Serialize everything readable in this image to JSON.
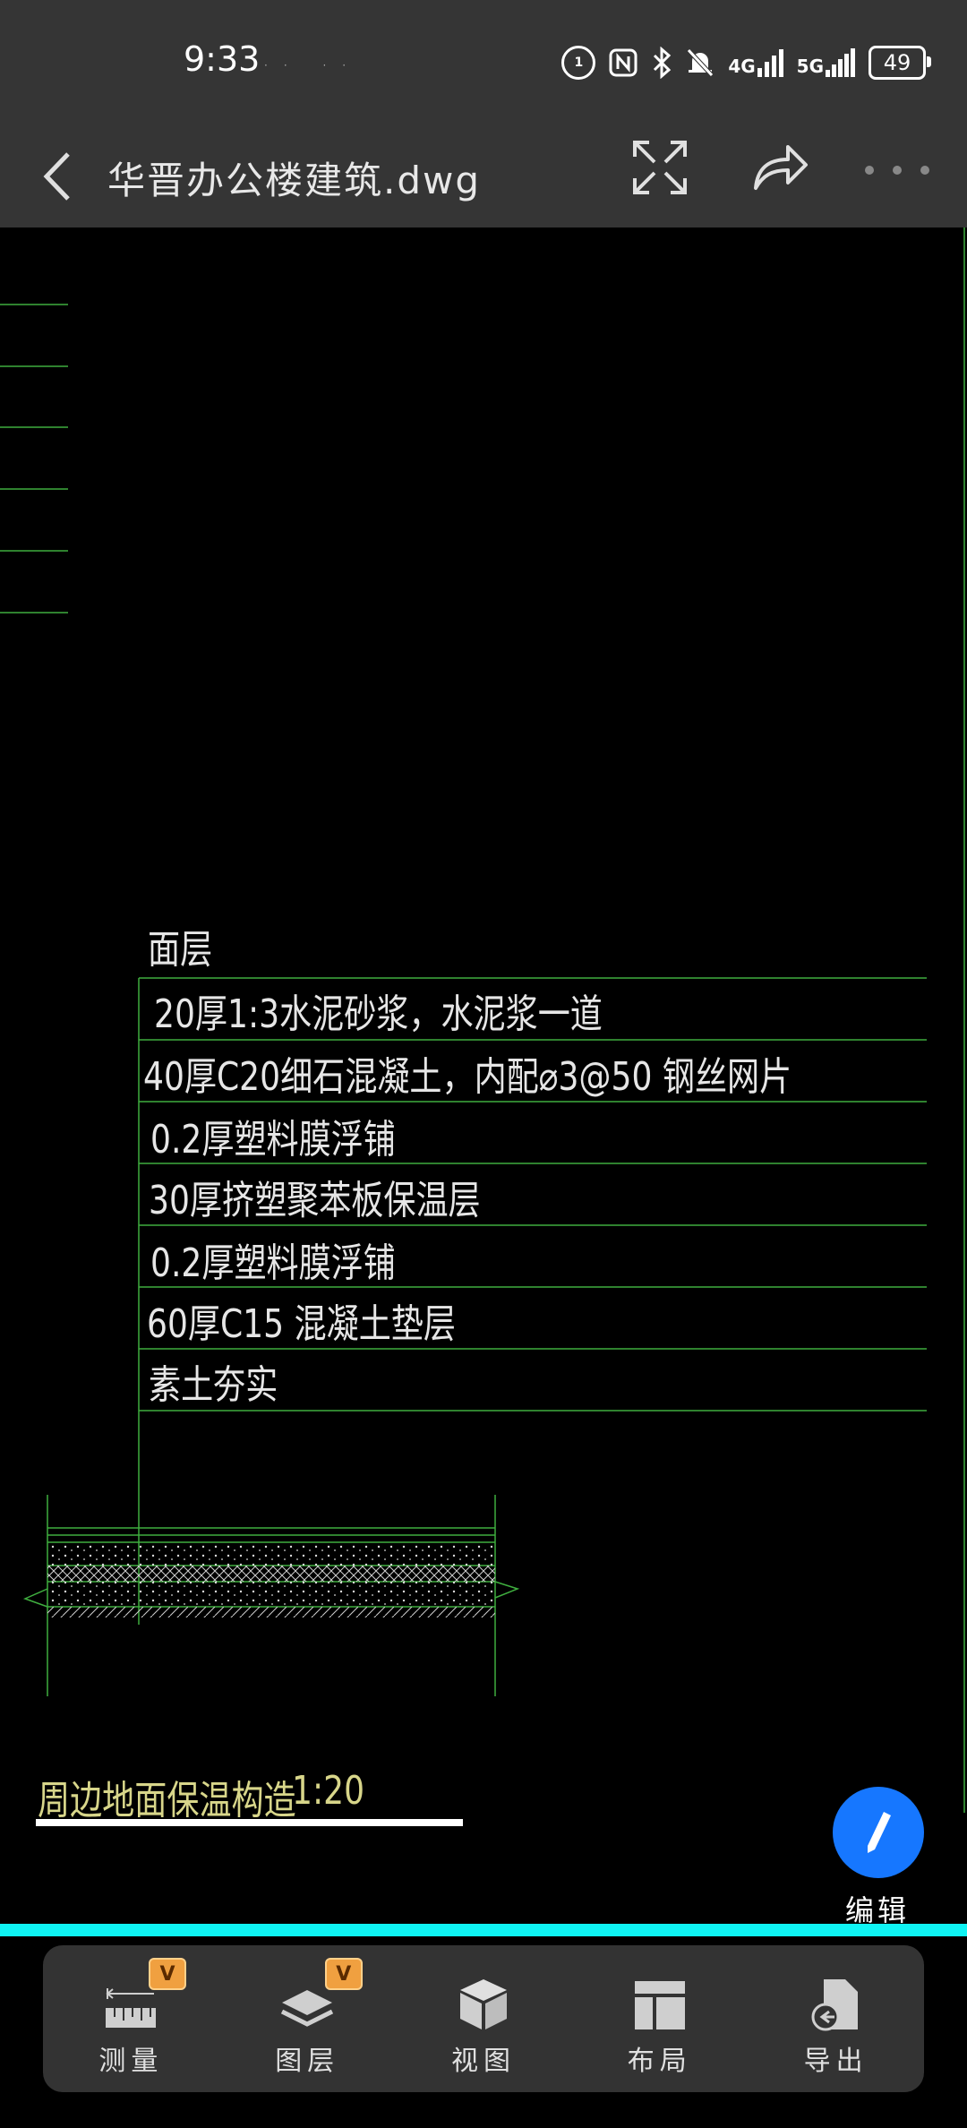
{
  "status": {
    "time": "9:33",
    "dots": "··  ··",
    "network_4g": "4G",
    "network_5g": "5G",
    "battery": "49"
  },
  "header": {
    "title": "华晋办公楼建筑.dwg"
  },
  "drawing": {
    "layer_header": "面层",
    "layers": [
      "20厚1:3水泥砂浆，水泥浆一道",
      "40厚C20细石混凝土，内配⌀3@50 钢丝网片",
      "0.2厚塑料膜浮铺",
      "30厚挤塑聚苯板保温层",
      "0.2厚塑料膜浮铺",
      "60厚C15 混凝土垫层",
      "素土夯实"
    ],
    "caption": "周边地面保温构造",
    "scale": "1:20",
    "colors": {
      "line": "#3fae3f",
      "text": "#e6e6e6",
      "caption": "#d8d68a"
    }
  },
  "edit": {
    "label": "编辑",
    "color": "#1677ff"
  },
  "toolbar": {
    "items": [
      {
        "label": "测量",
        "icon": "ruler-icon",
        "vip": "V"
      },
      {
        "label": "图层",
        "icon": "layers-icon",
        "vip": "V"
      },
      {
        "label": "视图",
        "icon": "cube-icon",
        "vip": ""
      },
      {
        "label": "布局",
        "icon": "layout-icon",
        "vip": ""
      },
      {
        "label": "导出",
        "icon": "export-icon",
        "vip": ""
      }
    ]
  }
}
